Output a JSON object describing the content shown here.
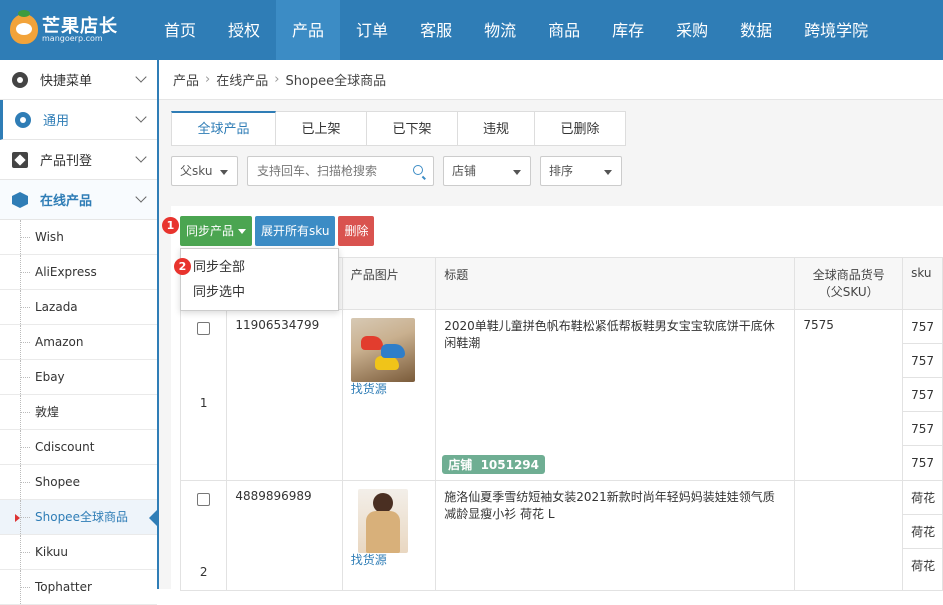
{
  "app": {
    "logo_title": "芒果店长",
    "logo_sub": "mangoerp.com"
  },
  "nav": [
    {
      "label": "首页"
    },
    {
      "label": "授权"
    },
    {
      "label": "产品"
    },
    {
      "label": "订单"
    },
    {
      "label": "客服"
    },
    {
      "label": "物流"
    },
    {
      "label": "商品"
    },
    {
      "label": "库存"
    },
    {
      "label": "采购"
    },
    {
      "label": "数据"
    },
    {
      "label": "跨境学院"
    }
  ],
  "sidebar": {
    "groups": [
      {
        "label": "快捷菜单",
        "icon": "gear-icon"
      },
      {
        "label": "通用",
        "icon": "gear-icon"
      },
      {
        "label": "产品刊登",
        "icon": "edit-icon"
      },
      {
        "label": "在线产品",
        "icon": "box-icon"
      }
    ],
    "items": [
      {
        "label": "Wish"
      },
      {
        "label": "AliExpress"
      },
      {
        "label": "Lazada"
      },
      {
        "label": "Amazon"
      },
      {
        "label": "Ebay"
      },
      {
        "label": "敦煌"
      },
      {
        "label": "Cdiscount"
      },
      {
        "label": "Shopee"
      },
      {
        "label": "Shopee全球商品"
      },
      {
        "label": "Kikuu"
      },
      {
        "label": "Tophatter"
      }
    ]
  },
  "breadcrumb": [
    "产品",
    "在线产品",
    "Shopee全球商品"
  ],
  "tabs": [
    {
      "label": "全球产品"
    },
    {
      "label": "已上架"
    },
    {
      "label": "已下架"
    },
    {
      "label": "违规"
    },
    {
      "label": "已删除"
    }
  ],
  "filters": {
    "parent_sku": "父sku",
    "search_placeholder": "支持回车、扫描枪搜索",
    "store": "店铺",
    "sort": "排序"
  },
  "actions": {
    "sync": "同步产品",
    "expand": "展开所有sku",
    "delete": "删除"
  },
  "badges": {
    "one": "1",
    "two": "2"
  },
  "dropdown": [
    "同步全部",
    "同步选中"
  ],
  "table": {
    "headers": [
      "产品图片",
      "标题",
      "全球商品货号\n（父SKU）",
      "sku"
    ],
    "rows": [
      {
        "index": "1",
        "id": "11906534799",
        "find_source": "找货源",
        "title": "2020单鞋儿童拼色帆布鞋松紧低帮板鞋男女宝宝软底饼干底休闲鞋潮",
        "parent_sku": "7575",
        "store_tag": "店铺",
        "store_id": "1051294",
        "skus": [
          "757",
          "757",
          "757",
          "757",
          "757"
        ]
      },
      {
        "index": "2",
        "id": "4889896989",
        "find_source": "找货源",
        "title": "施洛仙夏季雪纺短袖女装2021新款时尚年轻妈妈装娃娃领气质减龄显瘦小衫 荷花 L",
        "parent_sku": "",
        "skus": [
          "荷花",
          "荷花",
          "荷花"
        ]
      }
    ]
  }
}
